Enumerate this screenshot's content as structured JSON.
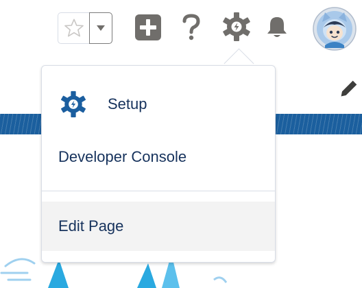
{
  "header": {
    "favorites_icon": "star-icon",
    "favorites_menu_icon": "caret-down-icon",
    "global_actions_icon": "plus-icon",
    "help_icon": "question-icon",
    "setup_icon": "gear-bolt-icon",
    "notifications_icon": "bell-icon",
    "avatar_icon": "astro-avatar"
  },
  "setup_menu": {
    "items": [
      {
        "label": "Setup",
        "icon": "gear-bolt-icon"
      },
      {
        "label": "Developer Console"
      },
      {
        "label": "Edit Page",
        "state": "hovered"
      }
    ]
  },
  "page": {
    "edit_icon": "pencil-icon"
  },
  "colors": {
    "brand_blue": "#0b5cab",
    "icon_gray": "#706e6b",
    "menu_text": "#16325c",
    "hover_bg": "#f3f3f3",
    "banner_blue": "#1b5f9e"
  }
}
